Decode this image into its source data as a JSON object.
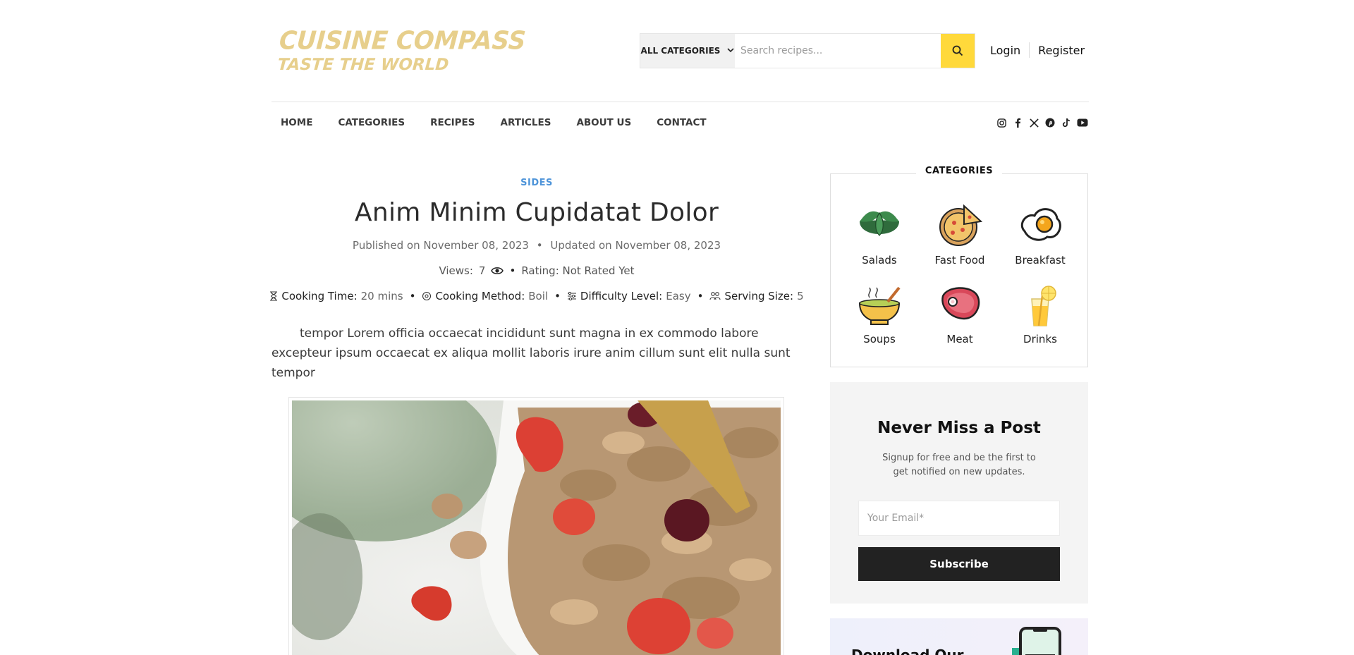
{
  "brand": {
    "name": "CUISINE COMPASS",
    "tagline": "TASTE THE WORLD",
    "color": "#e7cf8c"
  },
  "search": {
    "category": "ALL CATEGORIES",
    "placeholder": "Search recipes...",
    "button_icon": "search-icon"
  },
  "auth": {
    "login": "Login",
    "register": "Register"
  },
  "nav": [
    "HOME",
    "CATEGORIES",
    "RECIPES",
    "ARTICLES",
    "ABOUT US",
    "CONTACT"
  ],
  "social": [
    "instagram-icon",
    "facebook-icon",
    "x-icon",
    "pinterest-icon",
    "tiktok-icon",
    "youtube-icon"
  ],
  "post": {
    "category": "SIDES",
    "title": "Anim Minim Cupidatat Dolor",
    "published": "Published on November 08, 2023",
    "updated": "Updated on November 08, 2023",
    "views_label": "Views:",
    "views": "7",
    "rating": "Rating: Not Rated Yet",
    "meta": [
      {
        "icon": "hourglass-icon",
        "label": "Cooking Time:",
        "value": "20 mins"
      },
      {
        "icon": "method-icon",
        "label": "Cooking Method:",
        "value": "Boil"
      },
      {
        "icon": "sliders-icon",
        "label": "Difficulty Level:",
        "value": "Easy"
      },
      {
        "icon": "people-icon",
        "label": "Serving Size:",
        "value": "5"
      }
    ],
    "intro": "tempor Lorem officia occaecat incididunt sunt magna in ex commodo labore excepteur ipsum occaecat ex aliqua mollit laboris irure anim cillum sunt elit nulla sunt tempor",
    "accent": "#4e94d9"
  },
  "sidebar": {
    "categories_heading": "CATEGORIES",
    "categories": [
      {
        "label": "Salads",
        "icon": "salad-icon"
      },
      {
        "label": "Fast Food",
        "icon": "pizza-icon"
      },
      {
        "label": "Breakfast",
        "icon": "egg-icon"
      },
      {
        "label": "Soups",
        "icon": "soup-icon"
      },
      {
        "label": "Meat",
        "icon": "steak-icon"
      },
      {
        "label": "Drinks",
        "icon": "drink-icon"
      }
    ],
    "newsletter": {
      "title": "Never Miss a Post",
      "desc": "Signup for free and be the first to get notified on new updates.",
      "placeholder": "Your Email*",
      "button": "Subscribe"
    },
    "app": {
      "title": "Download Our"
    }
  },
  "colors": {
    "search_button": "#ffd93b",
    "subscribe": "#222222",
    "newsletter_bg": "#f4f4f4"
  }
}
